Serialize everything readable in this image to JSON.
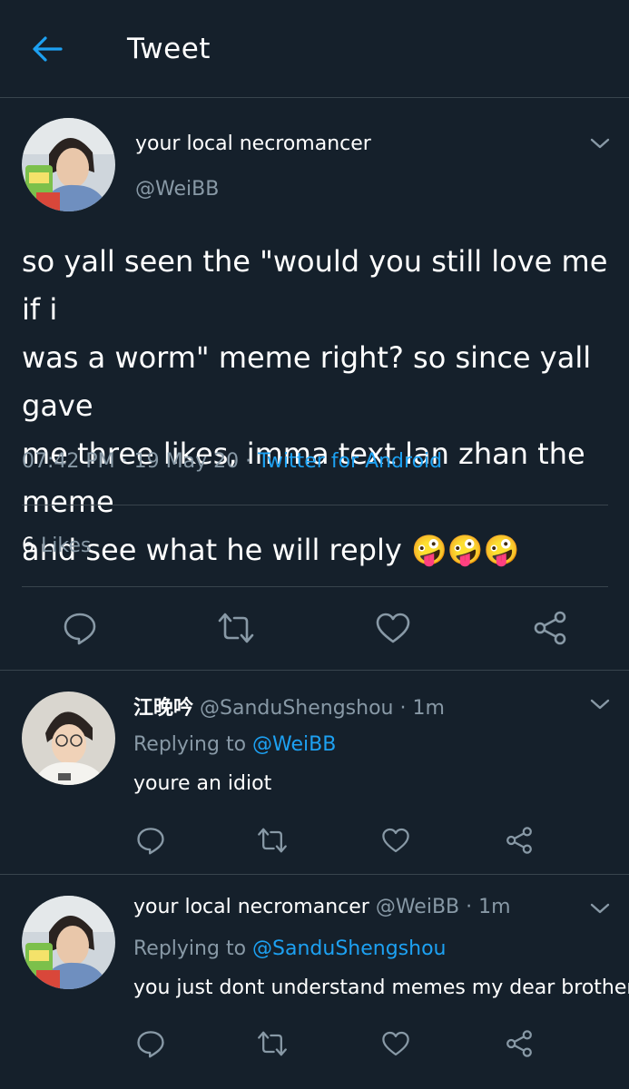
{
  "header": {
    "title": "Tweet"
  },
  "tweet": {
    "name": "your local necromancer",
    "handle": "@WeiBB",
    "text": "so yall seen the \"would you still love me if i\nwas a worm\" meme right? so since yall gave\nme three likes, imma text lan zhan the meme\nand see what he will reply 🤪🤪🤪",
    "time": "07:42 PM",
    "date": "19 May 20",
    "source": "Twitter for Android",
    "sep": " · ",
    "likes_count": "6",
    "likes_label": "Likes"
  },
  "replies": [
    {
      "name": "江晚吟",
      "handle": "@SanduShengshou",
      "time": "1m",
      "replying_prefix": "Replying to",
      "replying_to": "@WeiBB",
      "text": "youre an idiot"
    },
    {
      "name": "your local necromancer",
      "handle": "@WeiBB",
      "time": "1m",
      "replying_prefix": "Replying to",
      "replying_to": "@SanduShengshou",
      "text": "you just dont understand memes my dear brother"
    }
  ],
  "icons": {
    "back": "arrow-left-icon",
    "menu": "chevron-down-icon",
    "reply": "reply-icon",
    "retweet": "retweet-icon",
    "like": "heart-icon",
    "share": "share-icon"
  },
  "colors": {
    "background": "#15202b",
    "accent": "#1da1f2",
    "secondary_text": "#8899a6",
    "divider": "#38444d",
    "primary_text": "#ffffff"
  }
}
